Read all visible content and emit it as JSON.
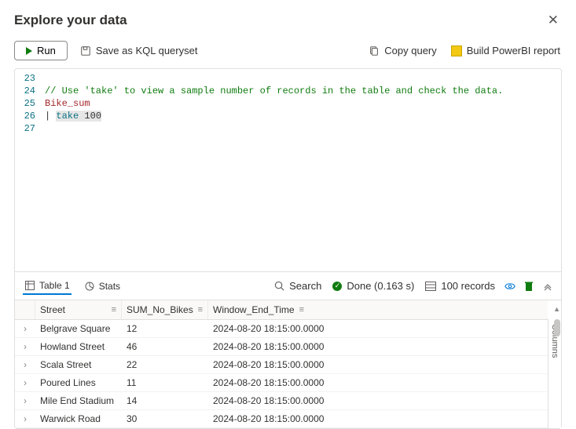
{
  "header": {
    "title": "Explore your data"
  },
  "toolbar": {
    "run": "Run",
    "save": "Save as KQL queryset",
    "copy": "Copy query",
    "pbi": "Build PowerBI report"
  },
  "editor": {
    "lineStart": 23,
    "lines": [
      {
        "num": 23,
        "segments": []
      },
      {
        "num": 24,
        "segments": [
          {
            "cls": "tok-comment",
            "text": "// Use 'take' to view a sample number of records in the table and check the data."
          }
        ]
      },
      {
        "num": 25,
        "segments": [
          {
            "cls": "tok-ident",
            "text": "Bike_sum"
          }
        ]
      },
      {
        "num": 26,
        "segments": [
          {
            "cls": "",
            "text": "| "
          },
          {
            "cls": "tok-keyword hl",
            "text": "take"
          },
          {
            "cls": "hl",
            "text": " 100"
          }
        ]
      },
      {
        "num": 27,
        "segments": []
      }
    ]
  },
  "tabs": {
    "table": "Table 1",
    "stats": "Stats"
  },
  "status": {
    "search": "Search",
    "done": "Done (0.163 s)",
    "records": "100 records"
  },
  "grid": {
    "headers": [
      "Street",
      "SUM_No_Bikes",
      "Window_End_Time"
    ],
    "rows": [
      {
        "street": "Belgrave Square",
        "sum": "12",
        "ts": "2024-08-20 18:15:00.0000"
      },
      {
        "street": "Howland Street",
        "sum": "46",
        "ts": "2024-08-20 18:15:00.0000"
      },
      {
        "street": "Scala Street",
        "sum": "22",
        "ts": "2024-08-20 18:15:00.0000"
      },
      {
        "street": "Poured Lines",
        "sum": "11",
        "ts": "2024-08-20 18:15:00.0000"
      },
      {
        "street": "Mile End Stadium",
        "sum": "14",
        "ts": "2024-08-20 18:15:00.0000"
      },
      {
        "street": "Warwick Road",
        "sum": "30",
        "ts": "2024-08-20 18:15:00.0000"
      }
    ]
  },
  "side": {
    "columns": "Columns"
  }
}
